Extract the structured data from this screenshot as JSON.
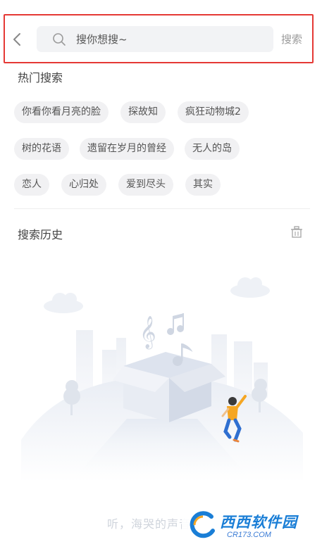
{
  "header": {
    "search_placeholder": "搜你想搜~",
    "search_button": "搜索"
  },
  "hot": {
    "title": "热门搜索",
    "tags_row1": [
      "你看你看月亮的脸",
      "探故知",
      "疯狂动物城2"
    ],
    "tags_row2": [
      "树的花语",
      "遗留在岁月的曾经",
      "无人的岛"
    ],
    "tags_row3": [
      "恋人",
      "心归处",
      "爱到尽头",
      "其实"
    ]
  },
  "history": {
    "title": "搜索历史",
    "empty_text": "听，海哭的声音"
  },
  "watermark": {
    "logo_text": "西西软件园",
    "url": "CR173.COM"
  },
  "colors": {
    "highlight": "#e53935",
    "tag_bg": "#f1f1f3",
    "accent_yellow": "#f5a623",
    "accent_blue": "#2f6fd0"
  }
}
